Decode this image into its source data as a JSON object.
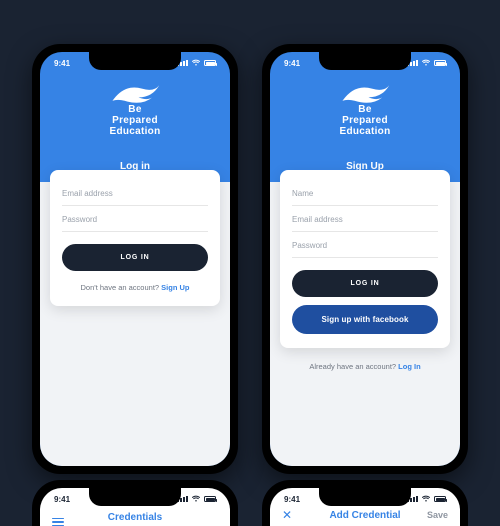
{
  "colors": {
    "bg": "#1a2332",
    "accent": "#3683e5",
    "facebook": "#1f4fa0"
  },
  "brand": {
    "name_line1": "Be",
    "name_line2": "Prepared",
    "name_line3": "Education"
  },
  "statusbar": {
    "time": "9:41"
  },
  "phoneA": {
    "title": "Log in",
    "fields": {
      "email_placeholder": "Email address",
      "password_placeholder": "Password"
    },
    "primary_button": "LOG IN",
    "foot_text": "Don't have an account? ",
    "foot_link": "Sign Up"
  },
  "phoneB": {
    "title": "Sign Up",
    "fields": {
      "name_placeholder": "Name",
      "email_placeholder": "Email address",
      "password_placeholder": "Password"
    },
    "primary_button": "LOG IN",
    "fb_text": "Sign up with ",
    "fb_bold": "facebook",
    "foot_text": "Already have an account? ",
    "foot_link": "Log In"
  },
  "peekA": {
    "title": "Credentials"
  },
  "peekB": {
    "title": "Add Credential",
    "right": "Save"
  }
}
